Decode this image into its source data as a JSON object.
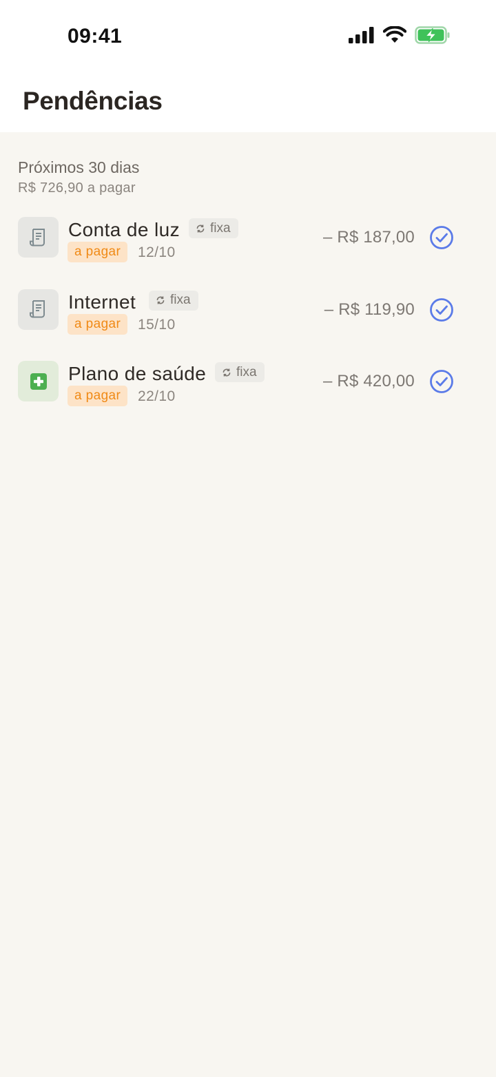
{
  "status_bar": {
    "time": "09:41",
    "icons": [
      "cellular-signal-icon",
      "wifi-icon",
      "battery-charging-icon"
    ]
  },
  "header": {
    "title": "Pendências"
  },
  "section": {
    "title": "Próximos 30 dias",
    "subtitle": "R$ 726,90 a pagar"
  },
  "items": [
    {
      "name": "Conta de luz",
      "tag": "fixa",
      "status": "a pagar",
      "date": "12/10",
      "amount": "– R$ 187,00",
      "icon": "receipt-icon"
    },
    {
      "name": "Internet",
      "tag": "fixa",
      "status": "a pagar",
      "date": "15/10",
      "amount": "– R$ 119,90",
      "icon": "receipt-icon"
    },
    {
      "name": "Plano de saúde",
      "tag": "fixa",
      "status": "a pagar",
      "date": "22/10",
      "amount": "– R$ 420,00",
      "icon": "health-plus-icon"
    }
  ],
  "colors": {
    "accent": "#5b7be8",
    "status_text": "#f08a16",
    "status_bg": "#fde3c7",
    "battery": "#3fc25a",
    "health_icon": "#4caf50"
  }
}
